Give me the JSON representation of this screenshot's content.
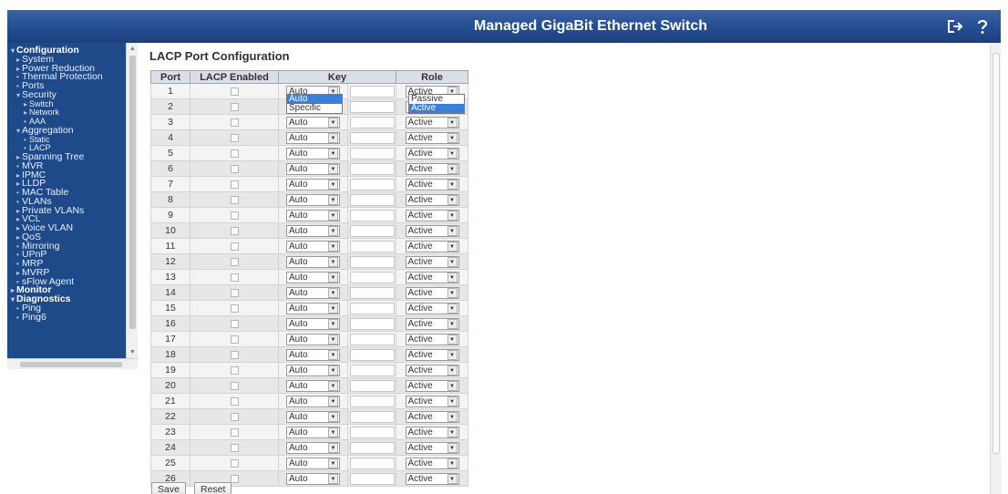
{
  "header": {
    "title": "Managed GigaBit Ethernet Switch",
    "logout_icon": "logout-icon",
    "help_icon": "help-icon"
  },
  "sidebar": {
    "items": [
      {
        "label": "Configuration",
        "level": 0,
        "bullet": "▾"
      },
      {
        "label": "System",
        "level": 1,
        "bullet": "▸"
      },
      {
        "label": "Power Reduction",
        "level": 1,
        "bullet": "▸"
      },
      {
        "label": "Thermal Protection",
        "level": 1,
        "bullet": "•"
      },
      {
        "label": "Ports",
        "level": 1,
        "bullet": "•"
      },
      {
        "label": "Security",
        "level": 1,
        "bullet": "▾"
      },
      {
        "label": "Switch",
        "level": 2,
        "bullet": "▸"
      },
      {
        "label": "Network",
        "level": 2,
        "bullet": "▸"
      },
      {
        "label": "AAA",
        "level": 2,
        "bullet": "•"
      },
      {
        "label": "Aggregation",
        "level": 1,
        "bullet": "▾"
      },
      {
        "label": "Static",
        "level": 2,
        "bullet": "•"
      },
      {
        "label": "LACP",
        "level": 2,
        "bullet": "•"
      },
      {
        "label": "Spanning Tree",
        "level": 1,
        "bullet": "▸"
      },
      {
        "label": "MVR",
        "level": 1,
        "bullet": "•"
      },
      {
        "label": "IPMC",
        "level": 1,
        "bullet": "▸"
      },
      {
        "label": "LLDP",
        "level": 1,
        "bullet": "▸"
      },
      {
        "label": "MAC Table",
        "level": 1,
        "bullet": "•"
      },
      {
        "label": "VLANs",
        "level": 1,
        "bullet": "•"
      },
      {
        "label": "Private VLANs",
        "level": 1,
        "bullet": "▸"
      },
      {
        "label": "VCL",
        "level": 1,
        "bullet": "▸"
      },
      {
        "label": "Voice VLAN",
        "level": 1,
        "bullet": "▸"
      },
      {
        "label": "QoS",
        "level": 1,
        "bullet": "▸"
      },
      {
        "label": "Mirroring",
        "level": 1,
        "bullet": "•"
      },
      {
        "label": "UPnP",
        "level": 1,
        "bullet": "•"
      },
      {
        "label": "MRP",
        "level": 1,
        "bullet": "•"
      },
      {
        "label": "MVRP",
        "level": 1,
        "bullet": "▸"
      },
      {
        "label": "sFlow Agent",
        "level": 1,
        "bullet": "•"
      },
      {
        "label": "Monitor",
        "level": 0,
        "bullet": "▸"
      },
      {
        "label": "Diagnostics",
        "level": 0,
        "bullet": "▾"
      },
      {
        "label": "Ping",
        "level": 1,
        "bullet": "•"
      },
      {
        "label": "Ping6",
        "level": 1,
        "bullet": "•"
      }
    ]
  },
  "main": {
    "title": "LACP Port Configuration",
    "columns": {
      "port": "Port",
      "lacp": "LACP Enabled",
      "key": "Key",
      "role": "Role"
    },
    "rows": [
      {
        "port": "1",
        "lacp_enabled": false,
        "key": "Auto",
        "key_value": "",
        "role": "Active"
      },
      {
        "port": "2",
        "lacp_enabled": false,
        "key": "Auto",
        "key_value": "",
        "role": "Active"
      },
      {
        "port": "3",
        "lacp_enabled": false,
        "key": "Auto",
        "key_value": "",
        "role": "Active"
      },
      {
        "port": "4",
        "lacp_enabled": false,
        "key": "Auto",
        "key_value": "",
        "role": "Active"
      },
      {
        "port": "5",
        "lacp_enabled": false,
        "key": "Auto",
        "key_value": "",
        "role": "Active"
      },
      {
        "port": "6",
        "lacp_enabled": false,
        "key": "Auto",
        "key_value": "",
        "role": "Active"
      },
      {
        "port": "7",
        "lacp_enabled": false,
        "key": "Auto",
        "key_value": "",
        "role": "Active"
      },
      {
        "port": "8",
        "lacp_enabled": false,
        "key": "Auto",
        "key_value": "",
        "role": "Active"
      },
      {
        "port": "9",
        "lacp_enabled": false,
        "key": "Auto",
        "key_value": "",
        "role": "Active"
      },
      {
        "port": "10",
        "lacp_enabled": false,
        "key": "Auto",
        "key_value": "",
        "role": "Active"
      },
      {
        "port": "11",
        "lacp_enabled": false,
        "key": "Auto",
        "key_value": "",
        "role": "Active"
      },
      {
        "port": "12",
        "lacp_enabled": false,
        "key": "Auto",
        "key_value": "",
        "role": "Active"
      },
      {
        "port": "13",
        "lacp_enabled": false,
        "key": "Auto",
        "key_value": "",
        "role": "Active"
      },
      {
        "port": "14",
        "lacp_enabled": false,
        "key": "Auto",
        "key_value": "",
        "role": "Active"
      },
      {
        "port": "15",
        "lacp_enabled": false,
        "key": "Auto",
        "key_value": "",
        "role": "Active"
      },
      {
        "port": "16",
        "lacp_enabled": false,
        "key": "Auto",
        "key_value": "",
        "role": "Active"
      },
      {
        "port": "17",
        "lacp_enabled": false,
        "key": "Auto",
        "key_value": "",
        "role": "Active"
      },
      {
        "port": "18",
        "lacp_enabled": false,
        "key": "Auto",
        "key_value": "",
        "role": "Active"
      },
      {
        "port": "19",
        "lacp_enabled": false,
        "key": "Auto",
        "key_value": "",
        "role": "Active"
      },
      {
        "port": "20",
        "lacp_enabled": false,
        "key": "Auto",
        "key_value": "",
        "role": "Active"
      },
      {
        "port": "21",
        "lacp_enabled": false,
        "key": "Auto",
        "key_value": "",
        "role": "Active"
      },
      {
        "port": "22",
        "lacp_enabled": false,
        "key": "Auto",
        "key_value": "",
        "role": "Active"
      },
      {
        "port": "23",
        "lacp_enabled": false,
        "key": "Auto",
        "key_value": "",
        "role": "Active"
      },
      {
        "port": "24",
        "lacp_enabled": false,
        "key": "Auto",
        "key_value": "",
        "role": "Active"
      },
      {
        "port": "25",
        "lacp_enabled": false,
        "key": "Auto",
        "key_value": "",
        "role": "Active"
      },
      {
        "port": "26",
        "lacp_enabled": false,
        "key": "Auto",
        "key_value": "",
        "role": "Active"
      }
    ],
    "key_dropdown": {
      "options": [
        "Auto",
        "Specific"
      ],
      "highlighted": "Auto"
    },
    "role_dropdown": {
      "options": [
        "Passive",
        "Active"
      ],
      "highlighted": "Active"
    }
  },
  "buttons": {
    "save": "Save",
    "reset": "Reset"
  },
  "colors": {
    "header": "#264f93",
    "sidebar": "#1f4a8a",
    "highlight": "#3b7fd9",
    "table_header": "#d9dee9"
  }
}
